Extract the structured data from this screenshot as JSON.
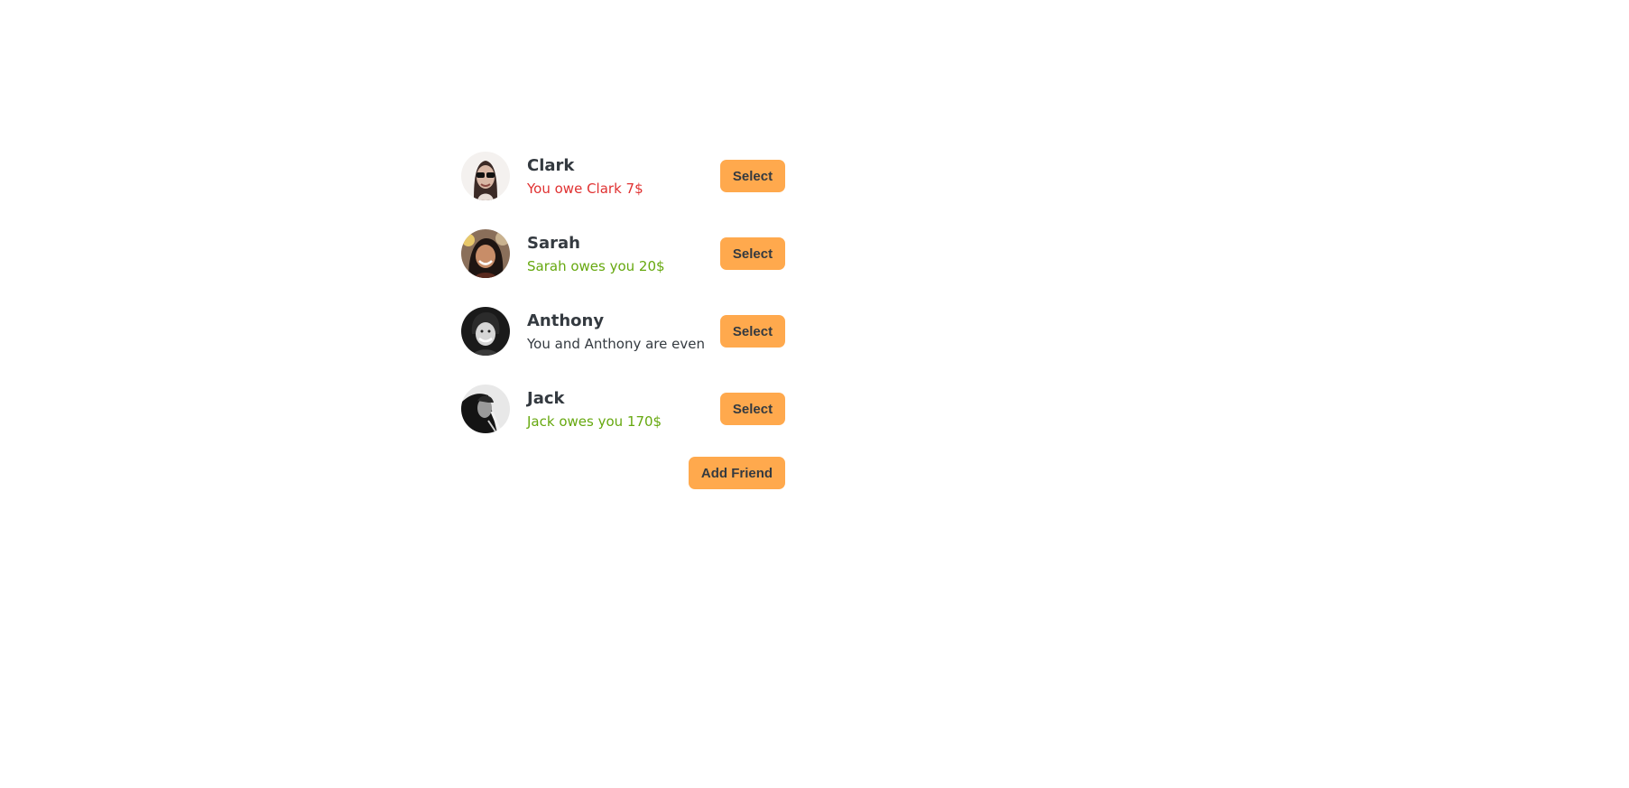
{
  "friends": [
    {
      "name": "Clark",
      "balance": "You owe Clark 7$",
      "status": "owe",
      "select_label": "Select",
      "avatar_icon": "avatar-clark"
    },
    {
      "name": "Sarah",
      "balance": "Sarah owes you 20$",
      "status": "owed",
      "select_label": "Select",
      "avatar_icon": "avatar-sarah"
    },
    {
      "name": "Anthony",
      "balance": "You and Anthony are even",
      "status": "even",
      "select_label": "Select",
      "avatar_icon": "avatar-anthony"
    },
    {
      "name": "Jack",
      "balance": "Jack owes you 170$",
      "status": "owed",
      "select_label": "Select",
      "avatar_icon": "avatar-jack"
    }
  ],
  "add_friend_label": "Add Friend",
  "colors": {
    "accent": "#ffa94d",
    "owe": "#e03131",
    "owed": "#66a80f",
    "text": "#343a40"
  }
}
